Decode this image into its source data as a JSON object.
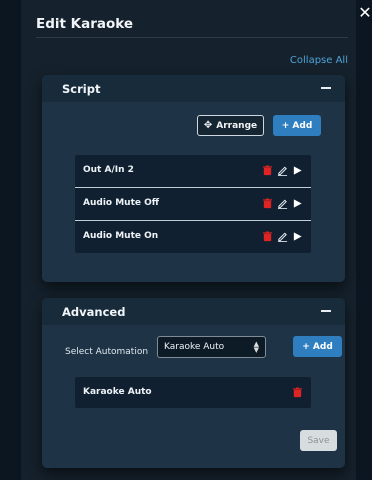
{
  "header": {
    "title": "Edit Karaoke",
    "close_icon": "close-icon"
  },
  "collapse_all_label": "Collapse All",
  "script_panel": {
    "title": "Script",
    "arrange_label": "Arrange",
    "add_label": "+ Add",
    "items": [
      {
        "label": "Out A/In 2"
      },
      {
        "label": "Audio Mute Off"
      },
      {
        "label": "Audio Mute On"
      }
    ]
  },
  "advanced_panel": {
    "title": "Advanced",
    "select_label": "Select Automation",
    "select_value": "Karaoke Auto",
    "add_label": "+ Add",
    "items": [
      {
        "label": "Karaoke Auto"
      }
    ],
    "save_label": "Save"
  },
  "colors": {
    "accent": "#2f7fc0",
    "delete": "#e02424",
    "link": "#4ea4d8"
  }
}
